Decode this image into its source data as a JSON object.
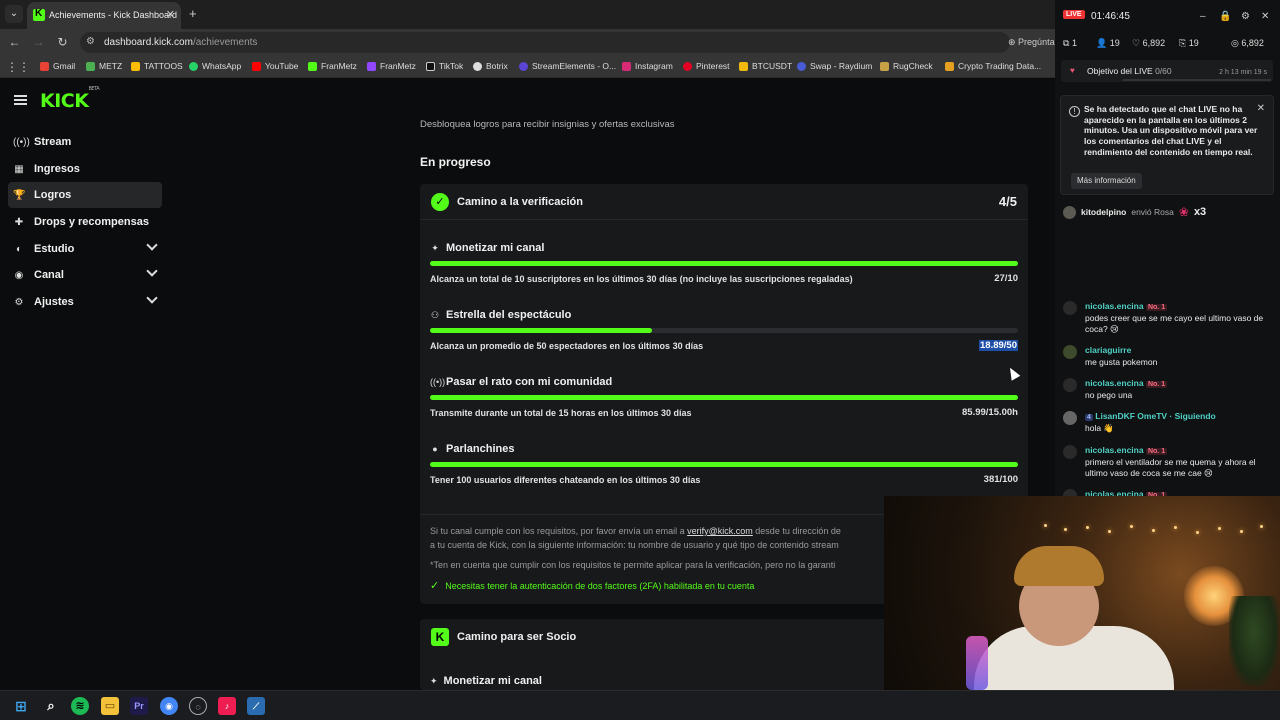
{
  "browser": {
    "tab_title": "Achievements - Kick Dashboard",
    "url_host": "dashboard.kick.com",
    "url_path": "/achievements",
    "bookmarks": [
      "Gmail",
      "METZ",
      "TATTOOS",
      "WhatsApp",
      "YouTube",
      "FranMetz",
      "FranMetz",
      "TikTok",
      "Botrix",
      "StreamElements - O...",
      "Instagram",
      "Pinterest",
      "BTCUSDT",
      "Swap - Raydium",
      "RugCheck",
      "Crypto Trading Data..."
    ],
    "omnibox_right_text": "Pregúnta"
  },
  "sidebar": {
    "logo": "KICK",
    "logo_sup": "BETA",
    "items": [
      {
        "label": "Stream",
        "icon": "broadcast-icon"
      },
      {
        "label": "Ingresos",
        "icon": "wallet-icon"
      },
      {
        "label": "Logros",
        "icon": "trophy-icon"
      },
      {
        "label": "Drops y recompensas",
        "icon": "gift-icon"
      },
      {
        "label": "Estudio",
        "icon": "studio-icon"
      },
      {
        "label": "Canal",
        "icon": "channel-icon"
      },
      {
        "label": "Ajustes",
        "icon": "gear-icon"
      }
    ]
  },
  "main": {
    "subtitle": "Desbloquea logros para recibir insignias y ofertas exclusivas",
    "section_title": "En progreso",
    "card1": {
      "title": "Camino a la verificación",
      "progress": "4/5",
      "requirements": [
        {
          "title": "Monetizar mi canal",
          "desc": "Alcanza un total de 10 suscriptores en los últimos 30 días (no incluye las suscripciones regaladas)",
          "value": "27/10",
          "fill": 1.0,
          "icon": "sparkle-icon"
        },
        {
          "title": "Estrella del espectáculo",
          "desc": "Alcanza un promedio de 50 espectadores en los últimos 30 días",
          "value": "18.89/50",
          "fill": 0.378,
          "icon": "viewers-icon"
        },
        {
          "title": "Pasar el rato con mi comunidad",
          "desc": "Transmite durante un total de 15 horas en los últimos 30 días",
          "value": "85.99/15.00h",
          "fill": 1.0,
          "icon": "broadcast-icon"
        },
        {
          "title": "Parlanchines",
          "desc": "Tener 100 usuarios diferentes chateando en los últimos 30 días",
          "value": "381/100",
          "fill": 1.0,
          "icon": "chat-bubble-icon"
        }
      ],
      "footer_line1_a": "Si tu canal cumple con los requisitos, por favor envía un email a ",
      "footer_email": "verify@kick.com",
      "footer_line1_b": " desde tu dirección de",
      "footer_line2": "a tu cuenta de Kick, con la siguiente información: tu nombre de usuario y qué tipo de contenido stream",
      "footer_line3": "*Ten en cuenta que cumplir con los requisitos te permite aplicar para la verificación, pero no la garanti",
      "twofa": "Necesitas tener la autenticación de dos factores (2FA) habilitada en tu cuenta"
    },
    "card2": {
      "title": "Camino para ser Socio",
      "first_req": "Monetizar mi canal"
    }
  },
  "overlay": {
    "live_label": "LIVE",
    "time": "01:46:45",
    "stats": [
      "1",
      "19",
      "6,892",
      "19",
      "6,892"
    ],
    "goal_label": "Objetivo del LIVE",
    "goal_value": "0/60",
    "goal_remaining": "2 h 13 min 19 s",
    "warning": "Se ha detectado que el chat LIVE no ha aparecido en la pantalla en los últimos 2 minutos. Usa un dispositivo móvil para ver los comentarios del chat LIVE y el rendimiento del contenido en tiempo real.",
    "more_info": "Más información",
    "gift_user": "kitodelpino",
    "gift_action": "envió Rosa",
    "gift_count": "x3",
    "messages": [
      {
        "user": "nicolas.encina",
        "badge": "No. 1",
        "text": "podes creer que se me cayo eel ultimo vaso de coca? 😢"
      },
      {
        "user": "clariaguirre",
        "badge": "",
        "text": "me gusta pokemon"
      },
      {
        "user": "nicolas.encina",
        "badge": "No. 1",
        "text": "no pego una"
      },
      {
        "user": "LisanDKF OmeTV · Siguiendo",
        "badge": "4",
        "text": "hola 👋"
      },
      {
        "user": "nicolas.encina",
        "badge": "No. 1",
        "text": "primero el ventilador se me quema y ahora el ultimo vaso de coca se me cae 😢"
      },
      {
        "user": "nicolas.encina",
        "badge": "No. 1",
        "text": ""
      }
    ]
  },
  "colors": {
    "accent": "#53fc18",
    "background": "#0b0c0d",
    "card": "#18191b"
  }
}
